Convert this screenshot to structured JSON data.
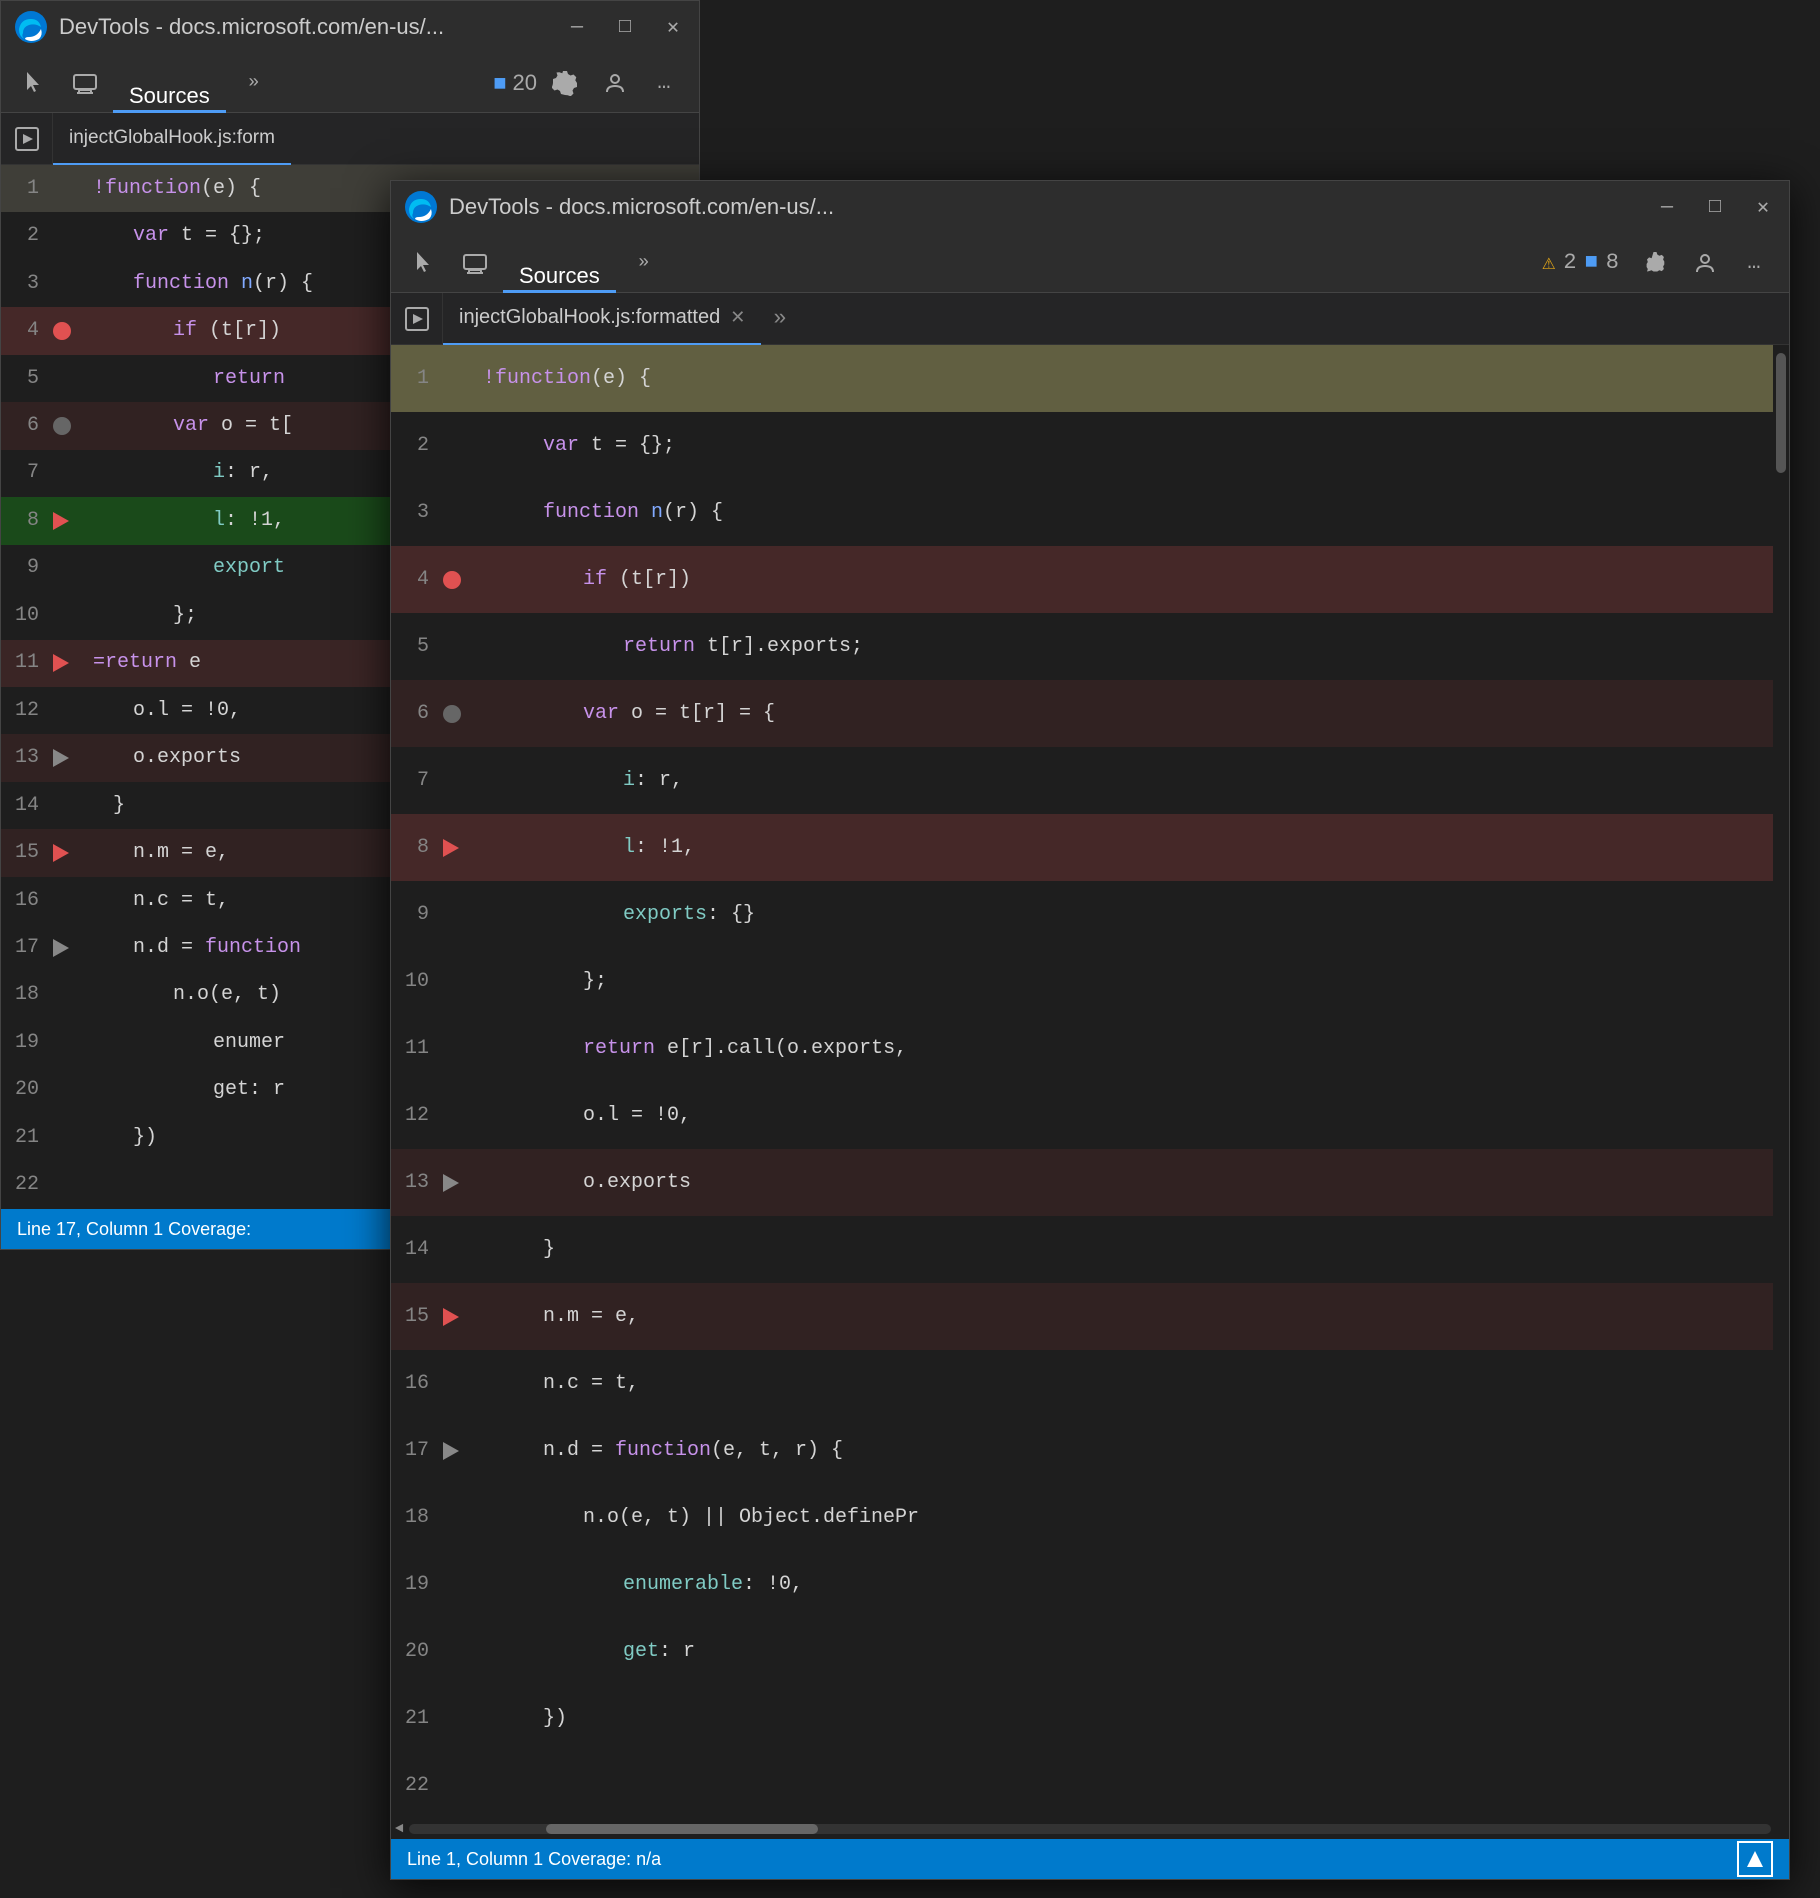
{
  "window1": {
    "titlebar": {
      "title": "DevTools - docs.microsoft.com/en-us/...",
      "controls": [
        "minimize",
        "maximize",
        "close"
      ]
    },
    "toolbar": {
      "tabs": [
        "Sources"
      ],
      "active_tab": "Sources",
      "badge_count": "20"
    },
    "file_tab": "injectGlobalHook.js:form",
    "status": "Line 17, Column 1   Coverage:"
  },
  "window2": {
    "titlebar": {
      "title": "DevTools - docs.microsoft.com/en-us/...",
      "controls": [
        "minimize",
        "maximize",
        "close"
      ]
    },
    "toolbar": {
      "tabs": [
        "Sources"
      ],
      "active_tab": "Sources",
      "warn_count": "2",
      "msg_count": "8"
    },
    "file_tab": "injectGlobalHook.js:formatted",
    "status": "Line 1, Column 1   Coverage: n/a"
  },
  "code_lines": [
    {
      "num": 1,
      "bp": null,
      "content": "!function(e) {",
      "highlight": "yellow"
    },
    {
      "num": 2,
      "bp": null,
      "content": "    var t = {};",
      "highlight": null
    },
    {
      "num": 3,
      "bp": null,
      "content": "    function n(r) {",
      "highlight": null
    },
    {
      "num": 4,
      "bp": "red-dot",
      "content": "        if (t[r])",
      "highlight": "red"
    },
    {
      "num": 5,
      "bp": null,
      "content": "            return t[r].exports;",
      "highlight": null
    },
    {
      "num": 6,
      "bp": "gray-dot",
      "content": "        var o = t[r] = {",
      "highlight": "red-light"
    },
    {
      "num": 7,
      "bp": null,
      "content": "            i: r,",
      "highlight": null
    },
    {
      "num": 8,
      "bp": "red-arrow",
      "content": "            l: !1,",
      "highlight": "red"
    },
    {
      "num": 9,
      "bp": null,
      "content": "            exports: {}",
      "highlight": null
    },
    {
      "num": 10,
      "bp": null,
      "content": "        };",
      "highlight": null
    },
    {
      "num": 11,
      "bp": null,
      "content": "        return e[r].call(o.exports,",
      "highlight": null
    },
    {
      "num": 12,
      "bp": null,
      "content": "        o.l = !0,",
      "highlight": null
    },
    {
      "num": 13,
      "bp": "gray-arrow",
      "content": "        o.exports",
      "highlight": "red-light"
    },
    {
      "num": 14,
      "bp": null,
      "content": "    }",
      "highlight": null
    },
    {
      "num": 15,
      "bp": "red-arrow",
      "content": "    n.m = e,",
      "highlight": "red-light"
    },
    {
      "num": 16,
      "bp": null,
      "content": "    n.c = t,",
      "highlight": null
    },
    {
      "num": 17,
      "bp": "gray-arrow",
      "content": "    n.d = function(e, t, r) {",
      "highlight": null
    },
    {
      "num": 18,
      "bp": null,
      "content": "        n.o(e, t) || Object.definePr",
      "highlight": null
    },
    {
      "num": 19,
      "bp": null,
      "content": "            enumerable: !0,",
      "highlight": null
    },
    {
      "num": 20,
      "bp": null,
      "content": "            get: r",
      "highlight": null
    },
    {
      "num": 21,
      "bp": null,
      "content": "    })",
      "highlight": null
    },
    {
      "num": 22,
      "bp": null,
      "content": "",
      "highlight": null
    }
  ],
  "colors": {
    "bg": "#1e1e1e",
    "toolbar": "#2d2d2d",
    "active_tab_line": "#4e9cf5",
    "bp_red": "#e05151",
    "bp_gray": "#666666",
    "highlight_yellow": "#fffacd",
    "highlight_red": "rgba(224,81,81,0.15)",
    "highlight_green": "#1a4a1a",
    "kw": "#c792ea",
    "fn_color": "#82aaff",
    "str": "#c3e88d",
    "num": "#f78c6c",
    "plain": "#d4d4d4",
    "prop": "#80cbc4",
    "status_blue": "#007acc"
  }
}
